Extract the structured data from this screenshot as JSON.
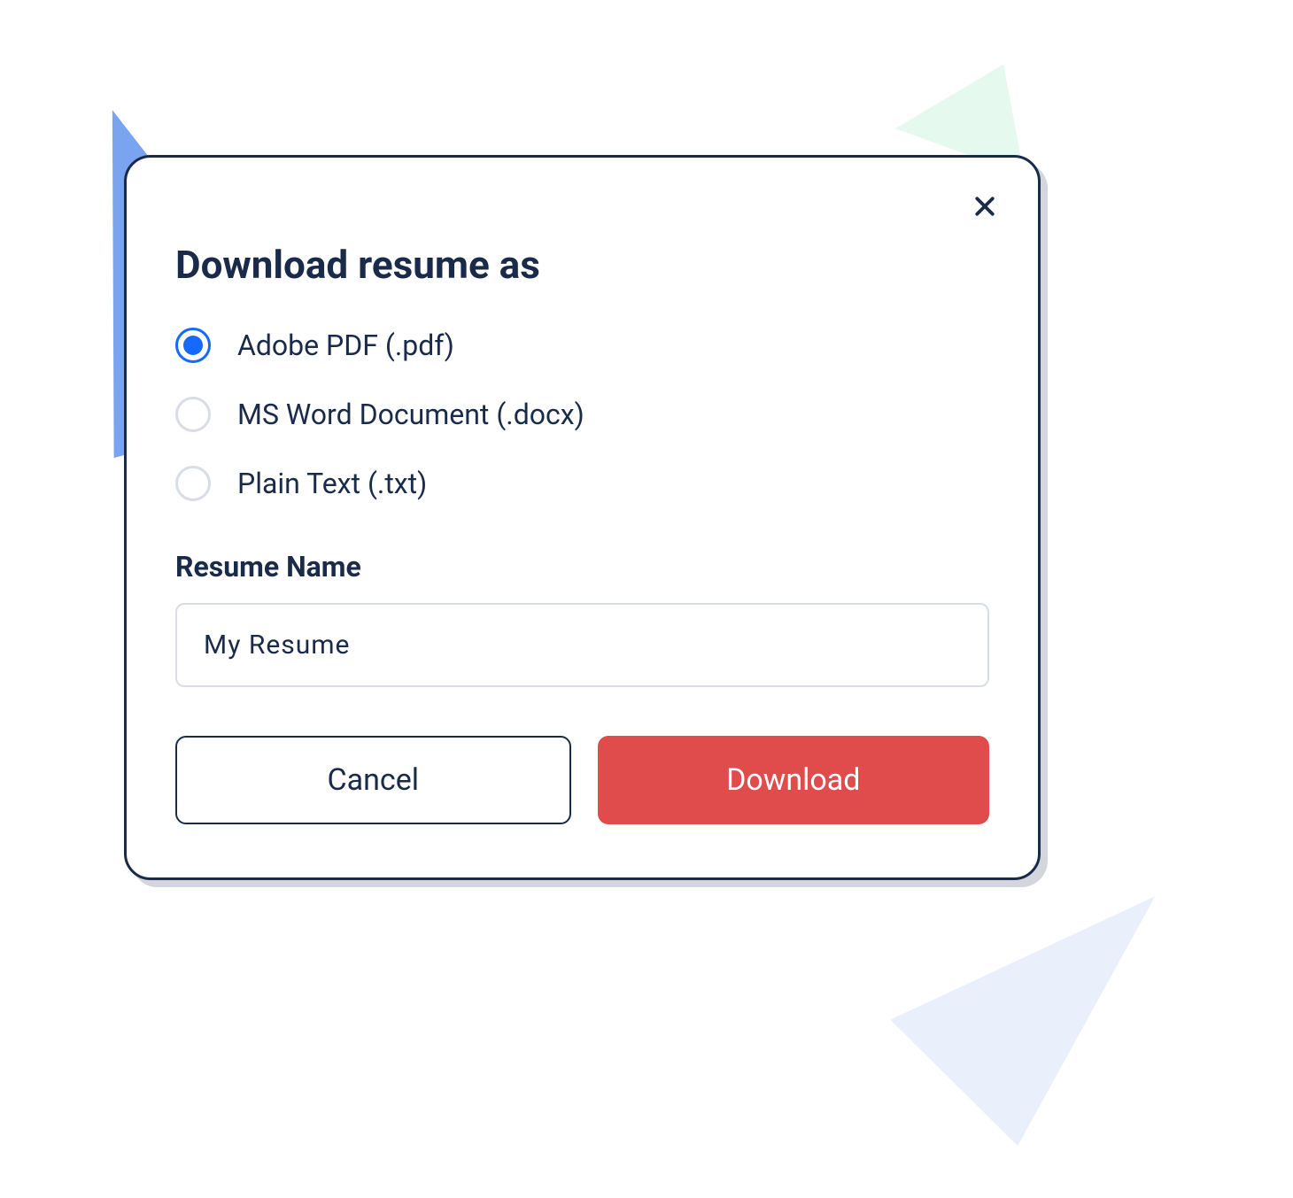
{
  "dialog": {
    "title": "Download resume as",
    "formats": [
      {
        "label": "Adobe PDF (.pdf)",
        "selected": true
      },
      {
        "label": "MS Word Document  (.docx)",
        "selected": false
      },
      {
        "label": "Plain Text (.txt)",
        "selected": false
      }
    ],
    "resume_name_label": "Resume Name",
    "resume_name_value": "My Resume",
    "cancel_label": "Cancel",
    "download_label": "Download"
  }
}
